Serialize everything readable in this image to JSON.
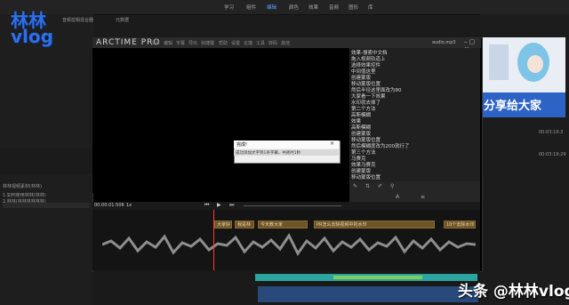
{
  "premiere": {
    "top_tabs": [
      "学习",
      "组件",
      "编辑",
      "颜色",
      "效果",
      "音频",
      "图形",
      "库"
    ],
    "active_tab": "编辑",
    "left_panel_title": "音频剪辑混合器",
    "left_panel_extra": "元数据",
    "left_project_lines": [
      "林林视频素材(林林)",
      "1.如何使用林林(林林)",
      "2.林林(林林林林林林)"
    ],
    "right_timecode": "00:03:19:3",
    "right_timecode2": "00:03:19:29"
  },
  "logo_text": "林林\nvlog",
  "arctime": {
    "app_title": "ARCTIME PRO",
    "menu": [
      "文件",
      "编辑",
      "字幕",
      "导出",
      "快捷键",
      "帮助",
      "设置",
      "云端",
      "工具",
      "转码",
      "其他"
    ],
    "audio_file": "audio.mp3",
    "subtitles": [
      "效果-搜索中文档",
      "拖入视频轨道上",
      "选择效果控件",
      "中间值这里",
      "创建蒙版",
      "移动蒙版位置",
      "然后半径这里面改为80",
      "大家看一下效果",
      "水印就去掉了",
      "第二个方法",
      "高斯模糊",
      "效果",
      "高斯模糊",
      "创建蒙版",
      "移动蒙版位置",
      "然后模糊度改为200就行了",
      "第三个方法",
      "马赛克",
      "效果马赛克",
      "创建蒙版",
      "移动蒙版位置"
    ],
    "timecode": "00:00:01:506",
    "zoom": "1x",
    "timeline_blocks": [
      {
        "label": "大家好"
      },
      {
        "label": "我是林"
      },
      {
        "label": "今天教大家"
      },
      {
        "label": "PR怎么去除视频中的水印"
      },
      {
        "label": "10个去除水印"
      }
    ]
  },
  "dialog": {
    "title": "完成!",
    "message": "成功添加文字到1条字幕，共耗时1秒"
  },
  "thumbnail": {
    "banner_text": "分享给大家"
  },
  "watermark": "头条 @林林vlog",
  "colors": {
    "accent": "#2f6fe8",
    "subtitle_block": "#6e5527",
    "playhead": "#ff3b30",
    "clip_teal": "#2aa5a0"
  }
}
